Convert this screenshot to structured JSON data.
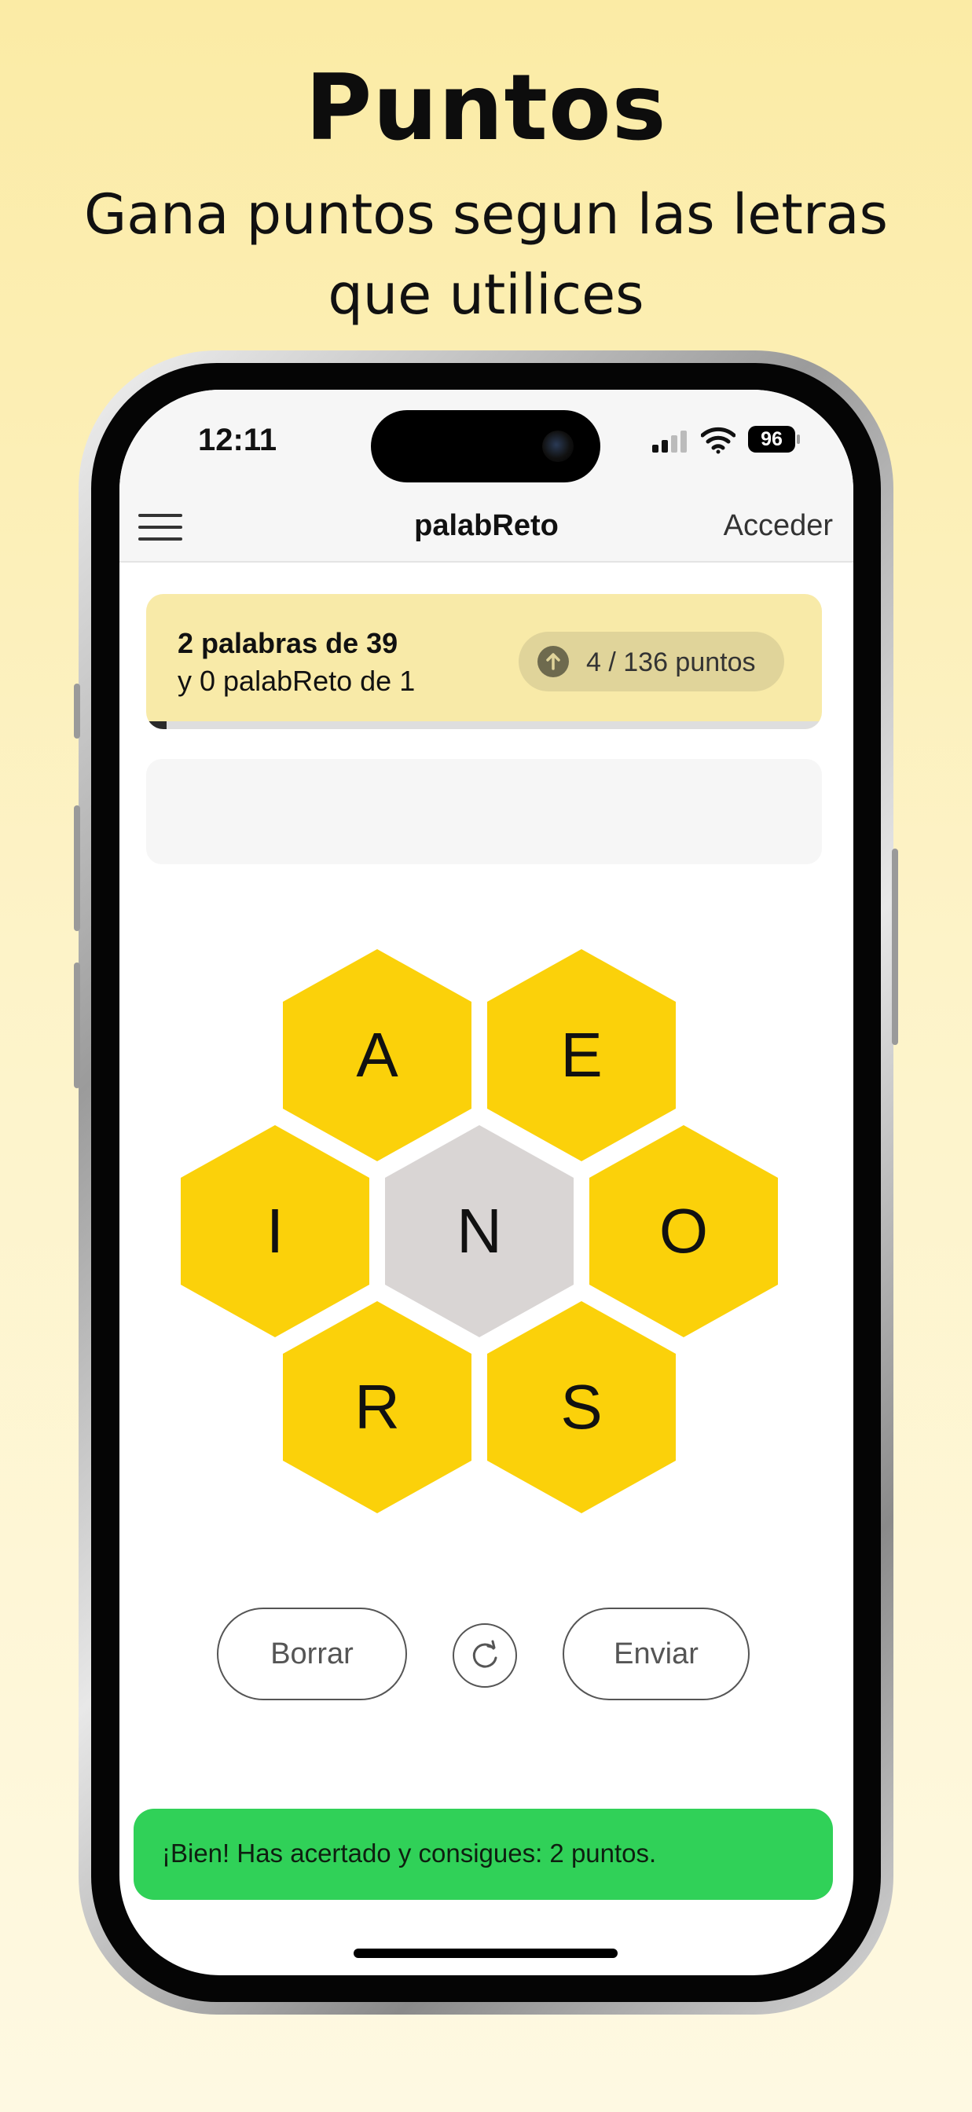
{
  "promo": {
    "title": "Puntos",
    "subtitle_line1": "Gana puntos segun las letras",
    "subtitle_line2": "que utilices"
  },
  "status_bar": {
    "time": "12:11",
    "battery": "96"
  },
  "nav": {
    "menu_icon": "hamburger-menu-icon",
    "title": "palabReto",
    "login": "Acceder"
  },
  "progress": {
    "words_found": "2 palabras de 39",
    "palabreto_found": "y 0 palabReto de 1",
    "points": "4 / 136 puntos",
    "points_icon": "arrow-up-circle-icon",
    "fraction": 0.03
  },
  "current_word": "",
  "hive": {
    "letters": {
      "top_left": "A",
      "top_right": "E",
      "middle_left": "I",
      "center": "N",
      "middle_right": "O",
      "bottom_left": "R",
      "bottom_right": "S"
    },
    "outer_color": "#fbd10a",
    "center_color": "#d9d5d4"
  },
  "controls": {
    "delete_label": "Borrar",
    "shuffle_icon": "refresh-icon",
    "submit_label": "Enviar"
  },
  "toast": {
    "message": "¡Bien! Has acertado y consigues: 2 puntos.",
    "color": "#30d158"
  }
}
